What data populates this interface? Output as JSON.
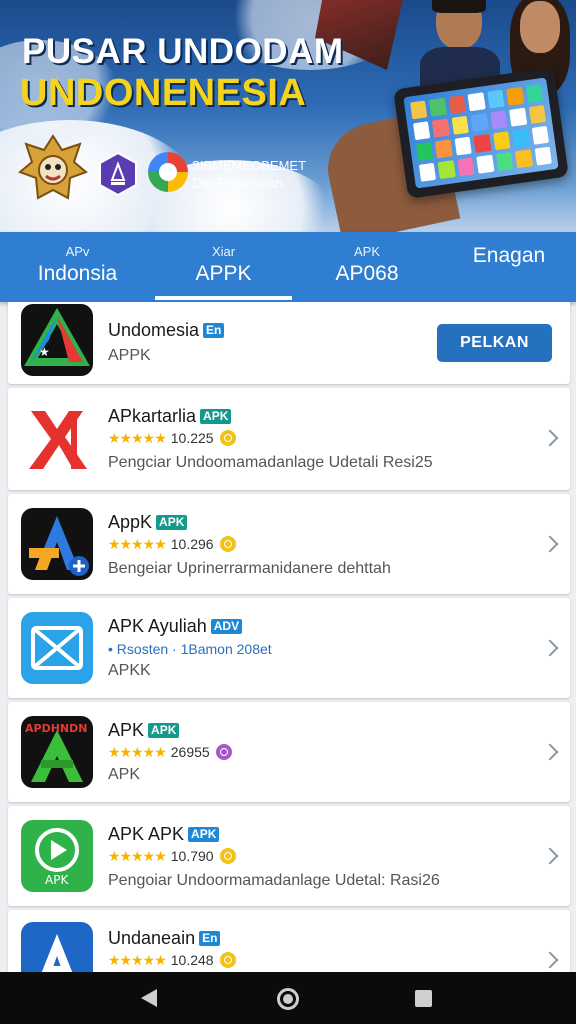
{
  "banner": {
    "title_line1": "PUSAR UNDODAM",
    "title_line2": "UNDONENESIA",
    "sub_line1": "ЗІВМЕМЕОВЕМЕТ",
    "sub_line2": "Die Eopensian"
  },
  "tabs": [
    {
      "small": "APv",
      "label": "Indonsia"
    },
    {
      "small": "Xiar",
      "label": "APPK"
    },
    {
      "small": "APK",
      "label": "AP068"
    },
    {
      "small": "",
      "label": "Enagan"
    }
  ],
  "active_tab": 1,
  "apps": [
    {
      "name": "Undomesia",
      "tag": "En",
      "sub": "APPK",
      "button": "PELKAN",
      "icon": "triangle-logo-icon"
    },
    {
      "name": "APkartarlia",
      "tag": "APK",
      "rating": "10.225",
      "desc": "Pengciar Undoomamadanlage Udetali Resi25",
      "icon": "red-x-logo-icon"
    },
    {
      "name": "AppK",
      "tag": "APK",
      "rating": "10.296",
      "desc": "Bengeiar Uprinerrarmanidanere dehttah",
      "icon": "letter-a-plus-icon"
    },
    {
      "name": "APK Ayuliah",
      "tag": "ADV",
      "meta": "• Rsosten  ·  1Bamon 208et",
      "sub": "APKK",
      "icon": "envelope-x-icon"
    },
    {
      "name": "APK",
      "tag": "APK",
      "rating": "26955",
      "sub": "APK",
      "icon": "green-a-logo-icon",
      "icon_text": "APDHNDN"
    },
    {
      "name": "APK APK",
      "tag": "APK",
      "rating": "10.790",
      "desc": "Pengoiar Undoormamadanlage Udetal: Rasi26",
      "icon": "play-icon",
      "icon_text": "APK"
    },
    {
      "name": "Undaneain",
      "tag": "En",
      "rating": "10.248",
      "icon": "letter-a-icon"
    }
  ],
  "stars": "★★★★★",
  "colors": {
    "primary": "#2f7ed1",
    "button": "#2471c0",
    "star": "#f5b300",
    "tag_blue": "#1f88d6",
    "tag_teal": "#14998a"
  }
}
